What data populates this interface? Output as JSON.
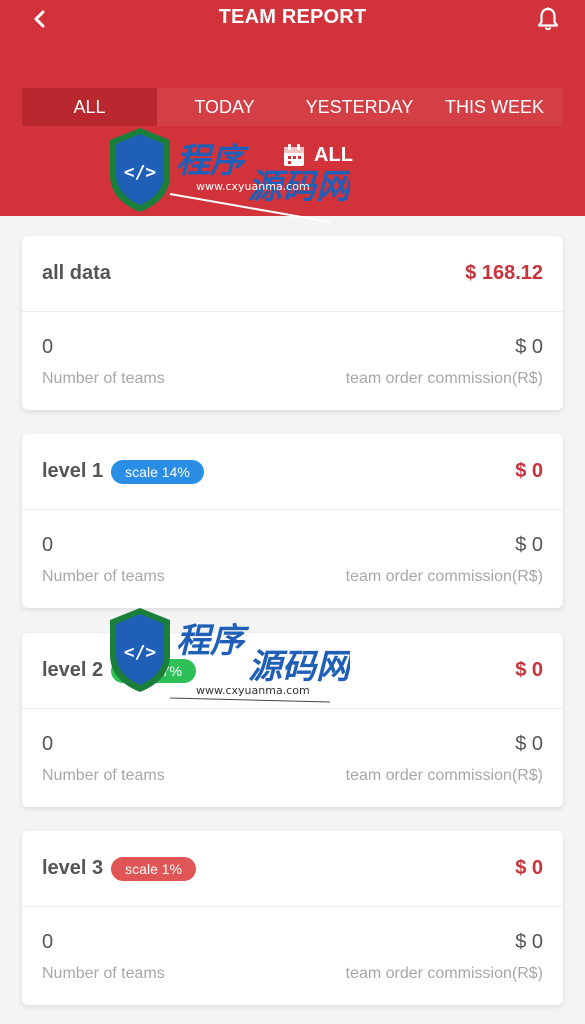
{
  "header": {
    "title": "TEAM REPORT",
    "back_icon": "chevron-left-icon",
    "bell_icon": "bell-icon",
    "background": "#d2333b"
  },
  "tabs": [
    {
      "label": "ALL",
      "active": true
    },
    {
      "label": "TODAY",
      "active": false
    },
    {
      "label": "YESTERDAY",
      "active": false
    },
    {
      "label": "THIS WEEK",
      "active": false
    }
  ],
  "date_filter": {
    "label": "ALL",
    "icon": "calendar-icon"
  },
  "summary": {
    "name": "all data",
    "amount": "$ 168.12",
    "teams_value": "0",
    "teams_label": "Number of teams",
    "commission_value": "$ 0",
    "commission_label": "team order commission(R$)"
  },
  "levels": [
    {
      "name": "level 1",
      "badge": "scale 14%",
      "badge_color": "#2a8de6",
      "amount": "$ 0",
      "teams_value": "0",
      "teams_label": "Number of teams",
      "commission_value": "$ 0",
      "commission_label": "team order commission(R$)"
    },
    {
      "name": "level 2",
      "badge": "scale 7%",
      "badge_color": "#2fbf57",
      "amount": "$ 0",
      "teams_value": "0",
      "teams_label": "Number of teams",
      "commission_value": "$ 0",
      "commission_label": "team order commission(R$)"
    },
    {
      "name": "level 3",
      "badge": "scale 1%",
      "badge_color": "#e05555",
      "amount": "$ 0",
      "teams_value": "0",
      "teams_label": "Number of teams",
      "commission_value": "$ 0",
      "commission_label": "team order commission(R$)"
    }
  ],
  "watermark": {
    "brand": "程序源码网",
    "url": "www.cxyuanma.com"
  }
}
